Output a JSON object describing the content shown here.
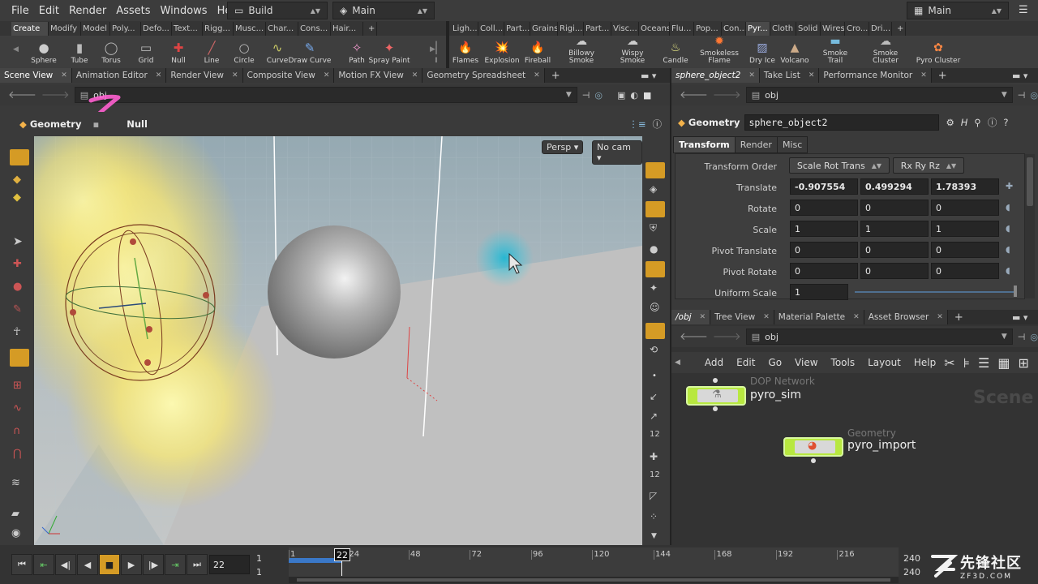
{
  "menubar": {
    "items": [
      "File",
      "Edit",
      "Render",
      "Assets",
      "Windows",
      "Help"
    ],
    "desktop_left": "Build",
    "desktop_mid": "Main",
    "desktop_right": "Main"
  },
  "shelf": {
    "tabs_left": [
      "Create",
      "Modify",
      "Model",
      "Poly...",
      "Defo...",
      "Text...",
      "Rigg...",
      "Musc...",
      "Char...",
      "Cons...",
      "Hair..."
    ],
    "tabs_right": [
      "Ligh...",
      "Coll...",
      "Part...",
      "Grains",
      "Rigi...",
      "Part...",
      "Visc...",
      "Oceans",
      "Flu...",
      "Pop...",
      "Con...",
      "Pyr...",
      "Cloth",
      "Solid",
      "Wires",
      "Cro...",
      "Dri..."
    ],
    "tools_left": [
      "Sphere",
      "Tube",
      "Torus",
      "Grid",
      "Null",
      "Line",
      "Circle",
      "Curve",
      "Draw Curve",
      "Path",
      "Spray Paint",
      "I"
    ],
    "tools_right": [
      "Flames",
      "Explosion",
      "Fireball",
      "Billowy Smoke",
      "Wispy Smoke",
      "Candle",
      "Smokeless Flame",
      "Dry Ice",
      "Volcano",
      "Smoke Trail",
      "Smoke Cluster",
      "Pyro Cluster"
    ]
  },
  "left_pane": {
    "tabs": [
      "Scene View",
      "Animation Editor",
      "Render View",
      "Composite View",
      "Motion FX View",
      "Geometry Spreadsheet"
    ],
    "path": "obj",
    "context": "Geometry",
    "context_node": "Null",
    "persp": "Persp",
    "cam": "No cam"
  },
  "params": {
    "tabs": [
      "sphere_object2",
      "Take List",
      "Performance Monitor"
    ],
    "path": "obj",
    "type": "Geometry",
    "node_name": "sphere_object2",
    "subtabs": [
      "Transform",
      "Render",
      "Misc"
    ],
    "transform_order_label": "Transform Order",
    "transform_order": "Scale Rot Trans",
    "rot_order": "Rx Ry Rz",
    "rows": [
      {
        "label": "Translate",
        "x": "-0.907554",
        "y": "0.499294",
        "z": "1.78393"
      },
      {
        "label": "Rotate",
        "x": "0",
        "y": "0",
        "z": "0"
      },
      {
        "label": "Scale",
        "x": "1",
        "y": "1",
        "z": "1"
      },
      {
        "label": "Pivot Translate",
        "x": "0",
        "y": "0",
        "z": "0"
      },
      {
        "label": "Pivot Rotate",
        "x": "0",
        "y": "0",
        "z": "0"
      }
    ],
    "uniform_label": "Uniform Scale",
    "uniform": "1"
  },
  "network": {
    "tabs": [
      "/obj",
      "Tree View",
      "Material Palette",
      "Asset Browser"
    ],
    "path": "obj",
    "menu": [
      "Add",
      "Edit",
      "Go",
      "View",
      "Tools",
      "Layout",
      "Help"
    ],
    "nodes": [
      {
        "type": "DOP Network",
        "name": "pyro_sim"
      },
      {
        "type": "Geometry",
        "name": "pyro_import"
      }
    ],
    "watermark": "Scene"
  },
  "timeline": {
    "frame": "22",
    "start": "1",
    "start2": "1",
    "end": "240",
    "end2": "240",
    "ticks": [
      "1",
      "24",
      "48",
      "72",
      "96",
      "120",
      "144",
      "168",
      "192",
      "216"
    ],
    "current_marker": "22"
  },
  "overlay": {
    "brand_cn": "先锋社区",
    "brand_url": "ZF3D.COM"
  }
}
